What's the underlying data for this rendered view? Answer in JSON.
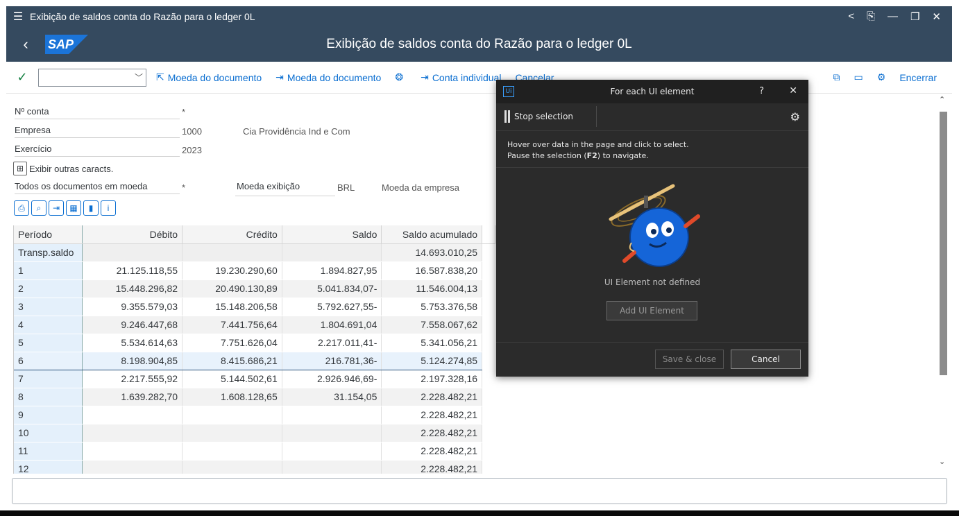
{
  "window": {
    "title": "Exibição de saldos conta do Razão para o ledger 0L",
    "controls": [
      "<",
      "⎘",
      "—",
      "❐",
      "✕"
    ]
  },
  "shell": {
    "logo": "SAP",
    "title": "Exibição de saldos conta do Razão para o ledger 0L"
  },
  "toolbar": {
    "btn1": "Moeda do documento",
    "btn2": "Moeda do documento",
    "btn3": "Conta individual",
    "btn4": "Cancelar",
    "exit": "Encerrar"
  },
  "form": {
    "conta_label": "Nº conta",
    "conta_value": "*",
    "empresa_label": "Empresa",
    "empresa_value": "1000",
    "empresa_name": "Cia Providência Ind e Com",
    "exercicio_label": "Exercício",
    "exercicio_value": "2023",
    "outras_label": "Exibir outras caracts.",
    "todos_label": "Todos os documentos em moeda",
    "todos_value": "*",
    "moeda_exib_label": "Moeda exibição",
    "moeda_exib_value": "BRL",
    "moeda_empresa_label": "Moeda da empresa"
  },
  "table": {
    "headers": [
      "Período",
      "Débito",
      "Crédito",
      "Saldo",
      "Saldo acumulado"
    ],
    "rows": [
      [
        "Transp.saldo",
        "",
        "",
        "",
        "14.693.010,25"
      ],
      [
        "1",
        "21.125.118,55",
        "19.230.290,60",
        "1.894.827,95",
        "16.587.838,20"
      ],
      [
        "2",
        "15.448.296,82",
        "20.490.130,89",
        "5.041.834,07-",
        "11.546.004,13"
      ],
      [
        "3",
        "9.355.579,03",
        "15.148.206,58",
        "5.792.627,55-",
        "5.753.376,58"
      ],
      [
        "4",
        "9.246.447,68",
        "7.441.756,64",
        "1.804.691,04",
        "7.558.067,62"
      ],
      [
        "5",
        "5.534.614,63",
        "7.751.626,04",
        "2.217.011,41-",
        "5.341.056,21"
      ],
      [
        "6",
        "8.198.904,85",
        "8.415.686,21",
        "216.781,36-",
        "5.124.274,85"
      ],
      [
        "7",
        "2.217.555,92",
        "5.144.502,61",
        "2.926.946,69-",
        "2.197.328,16"
      ],
      [
        "8",
        "1.639.282,70",
        "1.608.128,65",
        "31.154,05",
        "2.228.482,21"
      ],
      [
        "9",
        "",
        "",
        "",
        "2.228.482,21"
      ],
      [
        "10",
        "",
        "",
        "",
        "2.228.482,21"
      ],
      [
        "11",
        "",
        "",
        "",
        "2.228.482,21"
      ],
      [
        "12",
        "",
        "",
        "",
        "2.228.482,21"
      ]
    ],
    "selected_row": 6
  },
  "dialog": {
    "icon": "Ui",
    "title": "For each UI element",
    "help": "?",
    "close": "✕",
    "stop_label": "Stop selection",
    "hint_line1": "Hover over data in the page and click to select.",
    "hint_line2_pre": "Pause the selection (",
    "hint_key": "F2",
    "hint_line2_post": ") to navigate.",
    "not_defined": "UI Element not defined",
    "add_button": "Add UI Element",
    "save_button": "Save & close",
    "cancel_button": "Cancel"
  },
  "colors": {
    "shell": "#354a5f",
    "link": "#0a6ed1",
    "dialog_bg": "#2b2b2b",
    "selection_border": "#254f7a"
  }
}
